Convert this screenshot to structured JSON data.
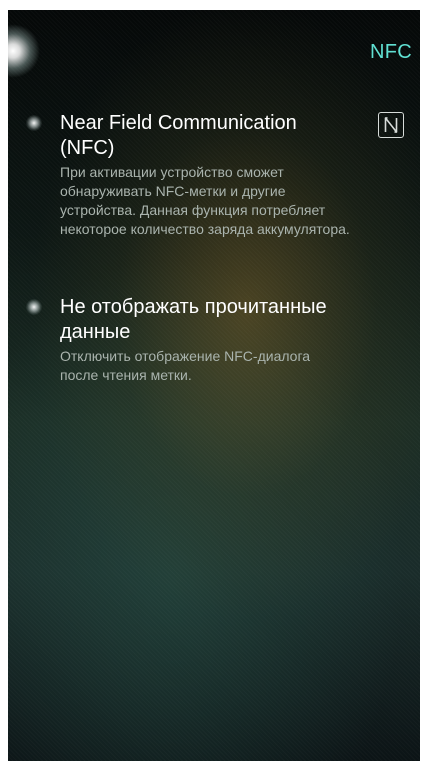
{
  "header": {
    "title": "NFC"
  },
  "settings": [
    {
      "title": "Near Field Communication (NFC)",
      "description": "При активации устройство сможет обнаруживать NFC-метки и другие устройства. Данная функция потребляет некоторое количество заряда аккумулятора.",
      "icon": "nfc-icon"
    },
    {
      "title": "Не отображать прочитанные данные",
      "description": "Отключить отображение NFC-диалога после чтения метки."
    }
  ],
  "colors": {
    "accent": "#5fe0d2",
    "title_text": "#ffffff",
    "description_text": "#a9b3ad"
  }
}
